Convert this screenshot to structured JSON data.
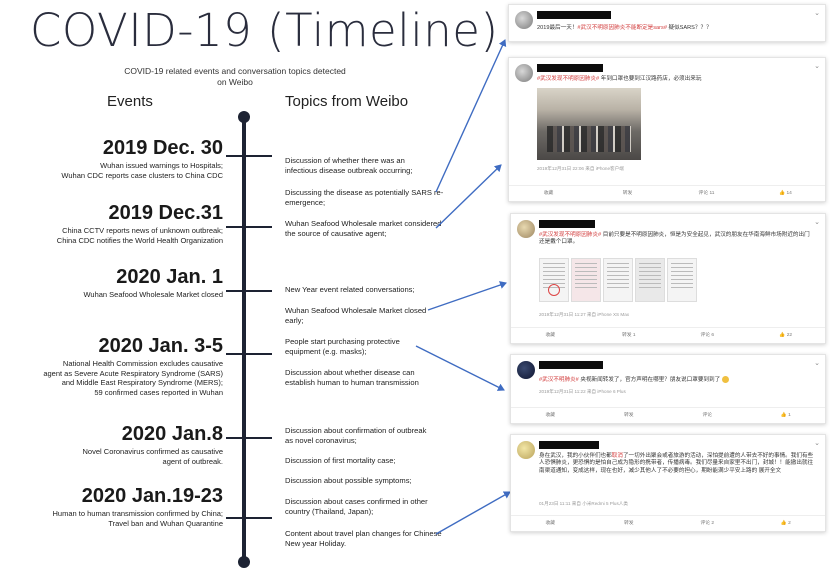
{
  "title": "COVID-19 (Timeline)",
  "subtitle": "COVID-19 related events and conversation topics detected on Weibo",
  "headers": {
    "events": "Events",
    "topics": "Topics from Weibo"
  },
  "events": [
    {
      "date": "2019 Dec. 30",
      "desc": "Wuhan issued warnings to Hospitals;\nWuhan CDC reports case clusters to China CDC"
    },
    {
      "date": "2019 Dec.31",
      "desc": "China CCTV reports news of unknown outbreak;\nChina CDC notifies the World Health Organization"
    },
    {
      "date": "2020 Jan. 1",
      "desc": "Wuhan Seafood Wholesale Market closed"
    },
    {
      "date": "2020 Jan. 3-5",
      "desc": "National Health Commission excludes causative\nagent as Severe Acute Respiratory Syndrome (SARS)\nand Middle East Respiratory Syndrome (MERS);\n59 confirmed cases reported in Wuhan"
    },
    {
      "date": "2020 Jan.8",
      "desc": "Novel Coronavirus confirmed as causative\nagent of outbreak."
    },
    {
      "date": "2020 Jan.19-23",
      "desc": "Human to human transmission confirmed by China;\nTravel ban and Wuhan Quarantine"
    }
  ],
  "topics": [
    "Discussion of whether there was an infectious disease outbreak occurring;",
    "Discussing the disease as potentially SARS re-emergence;",
    "Wuhan Seafood Wholesale market considered the source of causative agent;",
    "New Year event related conversations;",
    "Wuhan Seafood Wholesale Market closed early;",
    "People start purchasing protective equipment (e.g. masks);",
    "Discussion about whether disease can establish human to human transmission",
    "Discussion about confirmation of outbreak as novel coronavirus;",
    "Discussion of first mortality case;",
    "Discussion about possible symptoms;",
    "Discussion about cases confirmed in other country (Thailand, Japan);",
    "Content about travel plan changes for Chinese New year Holiday."
  ],
  "posts": [
    {
      "text_pre": "2019最后一天！",
      "text_hl": "#武汉不明原因肺炎不能断定是sars#",
      "text_post": " 疑似SARS？？？",
      "meta": "",
      "actions": []
    },
    {
      "text_pre": "",
      "text_hl": "#武汉发现不明原因肺炎#",
      "text_post": " 年到口罩也要到江汉路药店，必须出来玩",
      "meta": "2019年12月31日 22:06  来自 iPhone客户端",
      "actions": [
        "收藏",
        "转发",
        "评论 11",
        "14"
      ]
    },
    {
      "text_pre": "",
      "text_hl": "#武汉发现不明原因肺炎#",
      "text_post": " 目前只要是不明原因肺炎，恒是为安全起见，武汉的朋友在华南海鲜市场附近的出门还是戴个口罩。",
      "meta": "2019年12月31日 11:27  来自 iPhone XS Max",
      "actions": [
        "收藏",
        "转发 1",
        "评论 6",
        "22"
      ]
    },
    {
      "text_pre": "",
      "text_hl": "#武汉不明肺炎#",
      "text_post": " 央视新闻转发了，官方声明在哪里？朋友说口罩要到到了",
      "meta": "2019年12月31日 11:22  来自 iPhone 6 Plus",
      "actions": [
        "收藏",
        "转发",
        "评论",
        "1"
      ]
    },
    {
      "text_pre": "身在武汉，我的小伙伴们也都",
      "text_hl": "取消",
      "text_post": "了一切外出聚会或者旅游的活动，深怕提前遭的人带去不好的事情。我们有些人恐惧肺炎，更恐惧的是怕自己成为隐形的携带者，传播病毒。我们尽量来自家里不出门，封城！！能撤出就往南渠道通知，变成这样，现在也好，减少其他人了不必要的担心，期盼能满少平安上路的  展开全文",
      "meta": "01月23日 11:11  来自 小米Redmi 5 Plus人类",
      "actions": [
        "收藏",
        "转发",
        "评论 2",
        "2"
      ]
    }
  ],
  "colors": {
    "arrow": "#3f6cc2",
    "axis": "#1d2333",
    "title": "#2a2d3d"
  }
}
